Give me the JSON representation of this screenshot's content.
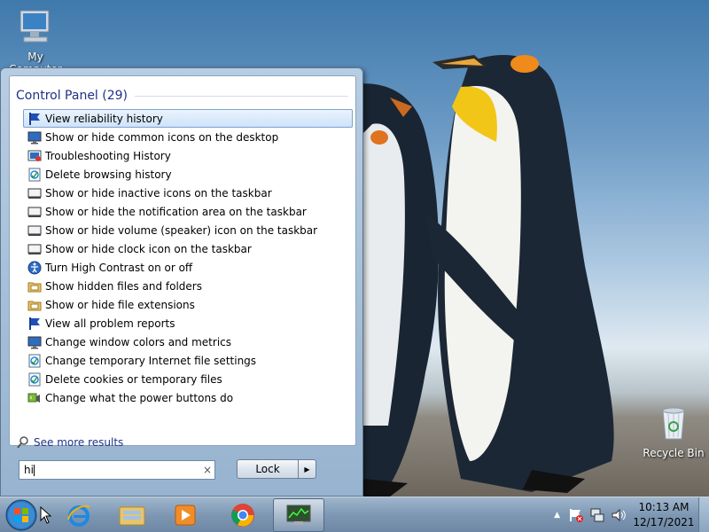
{
  "desktop": {
    "my_computer_label": "My Computer",
    "recycle_bin_label": "Recycle Bin"
  },
  "start_menu": {
    "group_title": "Control Panel (29)",
    "results": [
      {
        "label": "View reliability history",
        "icon": "flag-icon"
      },
      {
        "label": "Show or hide common icons on the desktop",
        "icon": "monitor-icon"
      },
      {
        "label": "Troubleshooting History",
        "icon": "troubleshoot-icon"
      },
      {
        "label": "Delete browsing history",
        "icon": "internet-options-icon"
      },
      {
        "label": "Show or hide inactive icons on the taskbar",
        "icon": "taskbar-icon"
      },
      {
        "label": "Show or hide the notification area on the taskbar",
        "icon": "taskbar-icon"
      },
      {
        "label": "Show or hide volume (speaker) icon on the taskbar",
        "icon": "taskbar-icon"
      },
      {
        "label": "Show or hide clock icon on the taskbar",
        "icon": "taskbar-icon"
      },
      {
        "label": "Turn High Contrast on or off",
        "icon": "ease-of-access-icon"
      },
      {
        "label": "Show hidden files and folders",
        "icon": "folder-options-icon"
      },
      {
        "label": "Show or hide file extensions",
        "icon": "folder-options-icon"
      },
      {
        "label": "View all problem reports",
        "icon": "flag-icon"
      },
      {
        "label": "Change window colors and metrics",
        "icon": "monitor-icon"
      },
      {
        "label": "Change temporary Internet file settings",
        "icon": "internet-options-icon"
      },
      {
        "label": "Delete cookies or temporary files",
        "icon": "internet-options-icon"
      },
      {
        "label": "Change what the power buttons do",
        "icon": "power-options-icon"
      }
    ],
    "see_more_label": "See more results",
    "search_value": "hi",
    "search_clear_glyph": "×",
    "lock_label": "Lock",
    "lock_arrow_glyph": "▶"
  },
  "taskbar": {
    "pinned": [
      "internet-explorer-icon",
      "windows-explorer-icon",
      "media-player-icon",
      "chrome-icon",
      "task-manager-icon"
    ],
    "clock_time": "10:13 AM",
    "clock_date": "12/17/2021"
  },
  "colors": {
    "accent_text": "#1e3287",
    "selection_border": "#7da2ce"
  }
}
